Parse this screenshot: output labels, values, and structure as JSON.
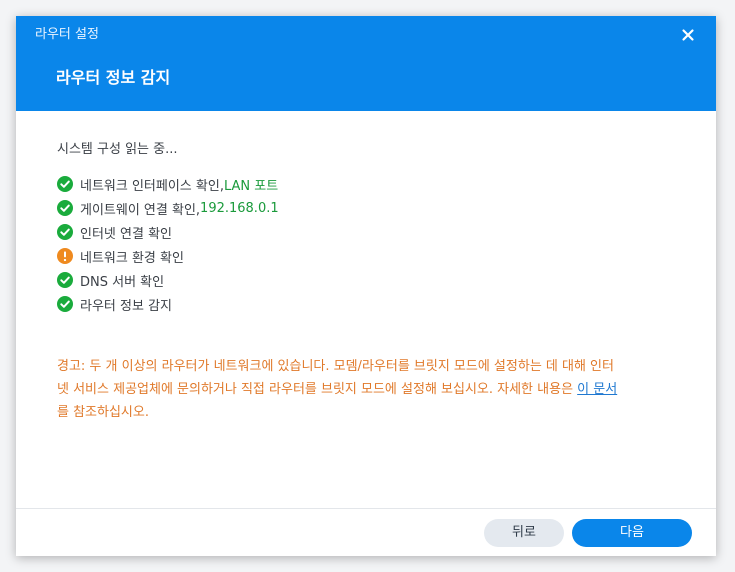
{
  "window": {
    "title": "라우터 설정",
    "close_icon": "close-icon"
  },
  "header": {
    "page_title": "라우터 정보 감지"
  },
  "content": {
    "status": "시스템 구성 읽는 중...",
    "checks": [
      {
        "label": "네트워크 인터페이스 확인, ",
        "value": "LAN 포트",
        "state": "success",
        "icon": "check-circle-icon"
      },
      {
        "label": "게이트웨이 연결 확인, ",
        "value": "192.168.0.1",
        "state": "success",
        "icon": "check-circle-icon"
      },
      {
        "label": "인터넷 연결 확인",
        "value": "",
        "state": "success",
        "icon": "check-circle-icon"
      },
      {
        "label": "네트워크 환경 확인",
        "value": "",
        "state": "warning",
        "icon": "warning-circle-icon"
      },
      {
        "label": "DNS 서버 확인",
        "value": "",
        "state": "success",
        "icon": "check-circle-icon"
      },
      {
        "label": "라우터 정보 감지",
        "value": "",
        "state": "success",
        "icon": "check-circle-icon"
      }
    ]
  },
  "warning": {
    "text_line1": "경고: 두 개 이상의 라우터가 네트워크에 있습니다. 모뎀/라우터를 브릿지 모드에 설정하는 데 대해 인터",
    "text_line2": "넷 서비스 제공업체에 문의하거나 직접 라우터를 브릿지 모드에 설정해 보십시오. 자세한 내용은 ",
    "link_text": "이 문서",
    "text_line3": "를 참조하십시오."
  },
  "footer": {
    "back_label": "뒤로",
    "next_label": "다음"
  },
  "colors": {
    "accent": "#0a86ea",
    "success": "#1aab3c",
    "warning": "#ef8a1f",
    "warning_text": "#e0792a",
    "link": "#1f78d1"
  }
}
